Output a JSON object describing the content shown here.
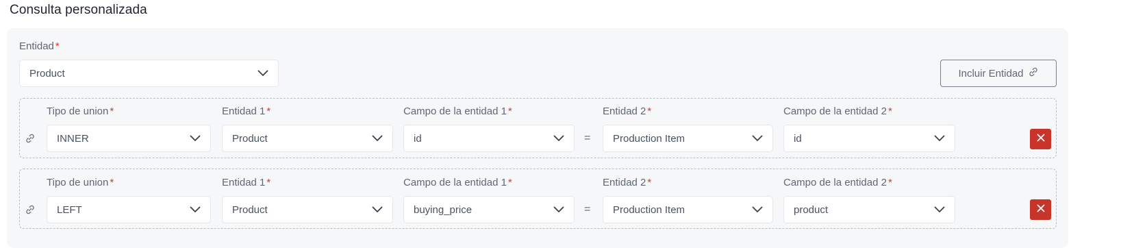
{
  "page": {
    "title": "Consulta personalizada"
  },
  "entity": {
    "label": "Entidad",
    "required_mark": "*",
    "value": "Product"
  },
  "include_button": {
    "label": "Incluir Entidad",
    "icon": "link-icon"
  },
  "joins": [
    {
      "join_type": {
        "label": "Tipo de union",
        "value": "INNER"
      },
      "entity1": {
        "label": "Entidad 1",
        "value": "Product"
      },
      "field1": {
        "label": "Campo de la entidad 1",
        "value": "id"
      },
      "equals": "=",
      "entity2": {
        "label": "Entidad 2",
        "value": "Production Item"
      },
      "field2": {
        "label": "Campo de la entidad 2",
        "value": "id"
      }
    },
    {
      "join_type": {
        "label": "Tipo de union",
        "value": "LEFT"
      },
      "entity1": {
        "label": "Entidad 1",
        "value": "Product"
      },
      "field1": {
        "label": "Campo de la entidad 1",
        "value": "buying_price"
      },
      "equals": "=",
      "entity2": {
        "label": "Entidad 2",
        "value": "Production Item"
      },
      "field2": {
        "label": "Campo de la entidad 2",
        "value": "product"
      }
    }
  ],
  "colors": {
    "required": "#d93a2b",
    "delete_button": "#c8342a",
    "panel_background": "#f6f7f9"
  }
}
